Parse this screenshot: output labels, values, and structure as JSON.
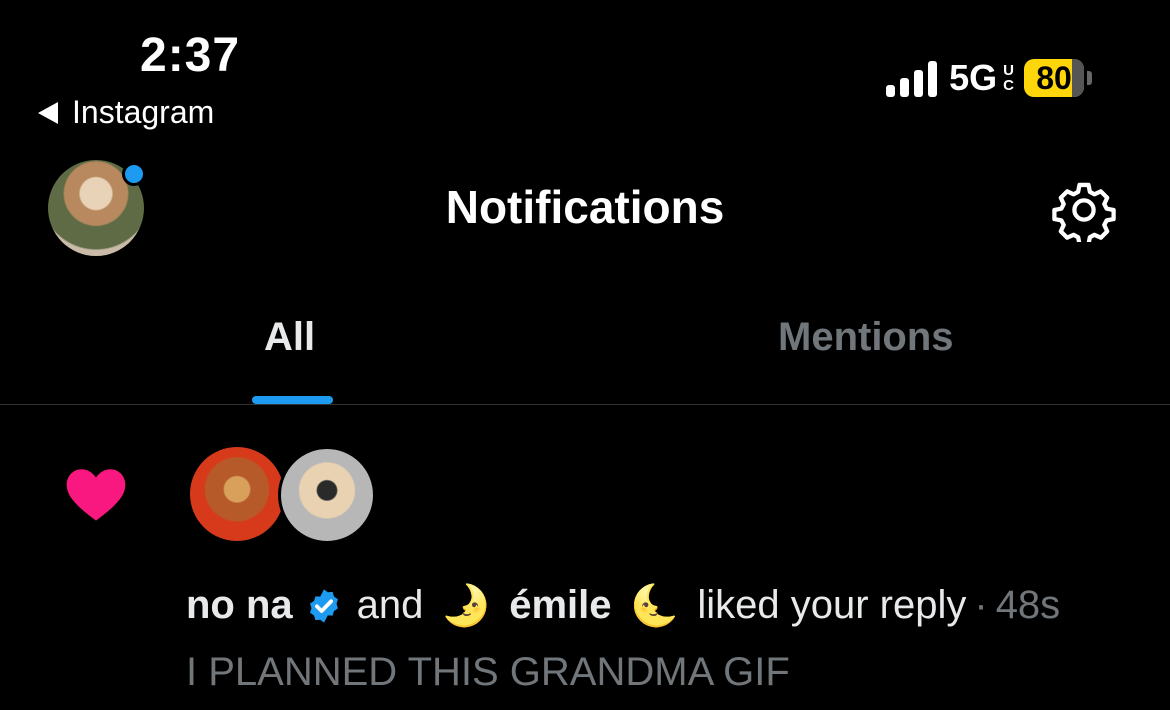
{
  "status_bar": {
    "time": "2:37",
    "back_app": "Instagram",
    "network": "5G",
    "network_suffix_top": "U",
    "network_suffix_bottom": "C",
    "battery": "80",
    "battery_color": "#ffd60a"
  },
  "header": {
    "title": "Notifications",
    "avatar_icon": "profile-avatar",
    "settings_icon": "gear-icon"
  },
  "tabs": {
    "all": "All",
    "mentions": "Mentions",
    "active": "All",
    "accent": "#1d9bf0"
  },
  "notification": {
    "icon": "heart-icon",
    "icon_color": "#f91880",
    "user1": "no na",
    "joiner": "and",
    "moon_left": "🌛",
    "user2": "émile",
    "moon_right": "🌜",
    "action": "liked your reply",
    "separator": "·",
    "time": "48s",
    "preview": "I PLANNED THIS GRANDMA GIF"
  }
}
